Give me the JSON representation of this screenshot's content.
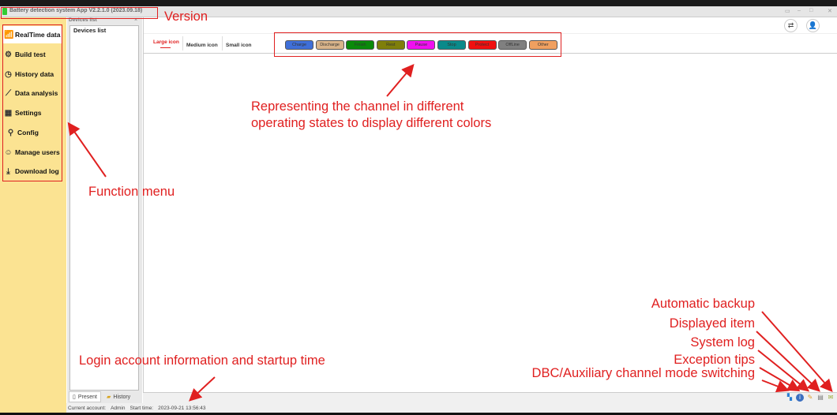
{
  "app": {
    "title": "Battery detection system App V2.2.1.0 (2023.09.18)",
    "window_buttons": [
      "restore",
      "minimize",
      "maximize",
      "close"
    ]
  },
  "sidebar": {
    "items": [
      {
        "label": "RealTime data",
        "icon": "chart-icon"
      },
      {
        "label": "Build test",
        "icon": "gear-icon"
      },
      {
        "label": "History data",
        "icon": "clock-icon"
      },
      {
        "label": "Data analysis",
        "icon": "line-chart-icon"
      },
      {
        "label": "Settings",
        "icon": "settings-panel-icon"
      },
      {
        "label": "Config",
        "icon": "config-icon"
      },
      {
        "label": "Manage users",
        "icon": "users-icon"
      },
      {
        "label": "Download log",
        "icon": "download-icon"
      }
    ],
    "active": 0
  },
  "devices": {
    "header": "Devices list",
    "close": "×",
    "root": "Devices list",
    "tabs": [
      {
        "label": "Present",
        "icon": "page-icon"
      },
      {
        "label": "History",
        "icon": "folder-icon"
      }
    ]
  },
  "view_tabs": [
    {
      "label": "Large icon",
      "active": true
    },
    {
      "label": "Medium icon"
    },
    {
      "label": "Small icon"
    }
  ],
  "states": [
    {
      "label": "Charge",
      "color": "#3f6fd8"
    },
    {
      "label": "Discharge",
      "color": "#d9b48a"
    },
    {
      "label": "Finish",
      "color": "#0a8a0a"
    },
    {
      "label": "Rest",
      "color": "#7f7f0a"
    },
    {
      "label": "Pause",
      "color": "#f010f0"
    },
    {
      "label": "Stop",
      "color": "#0a8a8a"
    },
    {
      "label": "Protect",
      "color": "#f01010"
    },
    {
      "label": "OffLine",
      "color": "#808080"
    },
    {
      "label": "Other",
      "color": "#f0a060"
    }
  ],
  "status": {
    "account_label": "Current account:",
    "account": "Admin",
    "start_label": "Start time:",
    "start_time": "2023-09-21 13:56:43"
  },
  "annotations": {
    "version": "Version",
    "states_line1": "Representing the channel in different",
    "states_line2": "operating states to display different colors",
    "function_menu": "Function menu",
    "login": "Login account information and startup time",
    "backup": "Automatic backup",
    "displayed": "Displayed item",
    "syslog": "System log",
    "exception": "Exception tips",
    "dbc": "DBC/Auxiliary channel mode switching"
  },
  "annotation_color": "#e02020"
}
